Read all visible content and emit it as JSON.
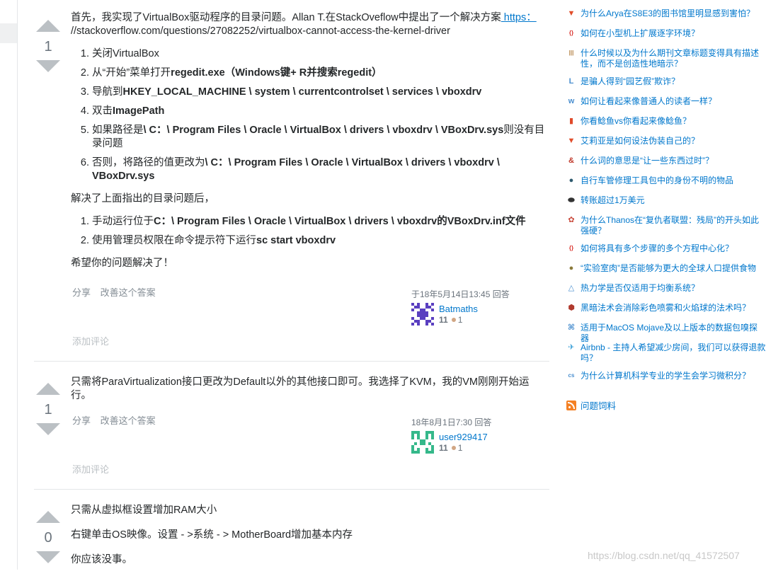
{
  "answers": [
    {
      "votes": "1",
      "intro_prefix": "首先，我实现了VirtualBox驱动程序的目录问题。Allan T.在StackOveflow中提出了一个解决方案",
      "link_text": " https： ",
      "link_rest": "//stackoverflow.com/questions/27082252/virtualbox-cannot-access-the-kernel-driver",
      "steps": [
        {
          "pre": "关闭VirtualBox",
          "bold": "",
          "post": ""
        },
        {
          "pre": "从“开始”菜单打开",
          "bold": "regedit.exe",
          "post": "（Windows键+ R并搜索regedit）"
        },
        {
          "pre": "导航到",
          "bold": "HKEY_LOCAL_MACHINE \\ system \\ currentcontrolset \\ services \\ vboxdrv",
          "post": ""
        },
        {
          "pre": "双击",
          "bold": "ImagePath",
          "post": ""
        },
        {
          "pre": "如果路径是",
          "bold": "\\ C：\\ Program Files \\ Oracle \\ VirtualBox \\ drivers \\ vboxdrv \\ VBoxDrv.sys",
          "post": "则没有目录问题"
        },
        {
          "pre": "否则，将路径的值更改为",
          "bold": "\\ C：\\ Program Files \\ Oracle \\ VirtualBox \\ drivers \\ vboxdrv \\ VBoxDrv.sys",
          "post": ""
        }
      ],
      "after_text": "解决了上面指出的目录问题后，",
      "steps2": [
        {
          "pre": "手动运行位于",
          "bold": "C：\\ Program Files \\ Oracle \\ VirtualBox \\ drivers \\ vboxdrv的VBoxDrv.inf文件",
          "post": ""
        },
        {
          "pre": "使用管理员权限在命令提示符下运行",
          "bold": "sc start vboxdrv",
          "post": ""
        }
      ],
      "closing": "希望你的问题解决了！",
      "share": "分享",
      "improve": "改善这个答案",
      "answered": "于18年5月14日13:45 回答",
      "user": "Batmaths",
      "rep": "11",
      "bronze": "1",
      "add_comment": "添加评论"
    },
    {
      "votes": "1",
      "text": "只需将ParaVirtualization接口更改为Default以外的其他接口即可。我选择了KVM，我的VM刚刚开始运行。",
      "share": "分享",
      "improve": "改善这个答案",
      "answered": "18年8月1日7:30 回答",
      "user": "user929417",
      "rep": "11",
      "bronze": "1",
      "add_comment": "添加评论"
    },
    {
      "votes": "0",
      "line1": "只需从虚拟框设置增加RAM大小",
      "line2": "右键单击OS映像。设置 - >系统 - > MotherBoard增加基本内存",
      "line3": "你应该没事。"
    }
  ],
  "sidebar": {
    "items": [
      {
        "icon": "scifi-icon",
        "color": "#e14d2a",
        "text": "为什么Arya在S8E3的图书馆里明显感到害怕？"
      },
      {
        "icon": "code-icon",
        "color": "#d9312b",
        "text": "如何在小型机上扩展逐字环境？"
      },
      {
        "icon": "books-icon",
        "color": "#b07c3c",
        "text": "什么时候以及为什么期刊文章标题变得具有描述性，而不是创造性地暗示？"
      },
      {
        "icon": "law-icon",
        "color": "#4a8fcf",
        "text": "是骗人得到“园艺假”欺诈？"
      },
      {
        "icon": "writing-icon",
        "color": "#4a8fcf",
        "text": "如何让看起来像普通人的读者一样？"
      },
      {
        "icon": "bookmark-icon",
        "color": "#e04a2a",
        "text": "你看鲶鱼vs你看起来像鲶鱼？"
      },
      {
        "icon": "scifi-icon",
        "color": "#e14d2a",
        "text": "艾莉亚是如何设法伪装自己的？"
      },
      {
        "icon": "english-icon",
        "color": "#c0392b",
        "text": "什么词的意思是“让一些东西过时”？"
      },
      {
        "icon": "bicycle-icon",
        "color": "#2e5a6e",
        "text": "自行车管修理工具包中的身份不明的物品"
      },
      {
        "icon": "money-icon",
        "color": "#333333",
        "text": "转账超过1万美元"
      },
      {
        "icon": "movies-icon",
        "color": "#c94a3c",
        "text": "为什么Thanos在“复仇者联盟：残局”的开头如此强硬？"
      },
      {
        "icon": "code-icon",
        "color": "#d9312b",
        "text": "如何将具有多个步骤的多个方程中心化？"
      },
      {
        "icon": "worldbuilding-icon",
        "color": "#8a7a3a",
        "text": "“实验室肉”是否能够为更大的全球人口提供食物"
      },
      {
        "icon": "physics-icon",
        "color": "#4a8fcf",
        "text": "热力学是否仅适用于均衡系统？"
      },
      {
        "icon": "rpg-icon",
        "color": "#b03a2e",
        "text": "黑暗法术会消除彩色喷雾和火焰球的法术吗？"
      },
      {
        "icon": "apple-cmd-icon",
        "color": "#4a8fcf",
        "text": "适用于MacOS Mojave及以上版本的数据包嗅探器"
      },
      {
        "icon": "travel-icon",
        "color": "#3aa0d8",
        "text": "Airbnb - 主持人希望减少房间，我们可以获得退款吗？"
      },
      {
        "icon": "cs-icon",
        "color": "#4a8fcf",
        "text": "为什么计算机科学专业的学生会学习微积分？"
      }
    ],
    "feed": "问题饲料"
  },
  "watermark": "https://blog.csdn.net/qq_41572507"
}
